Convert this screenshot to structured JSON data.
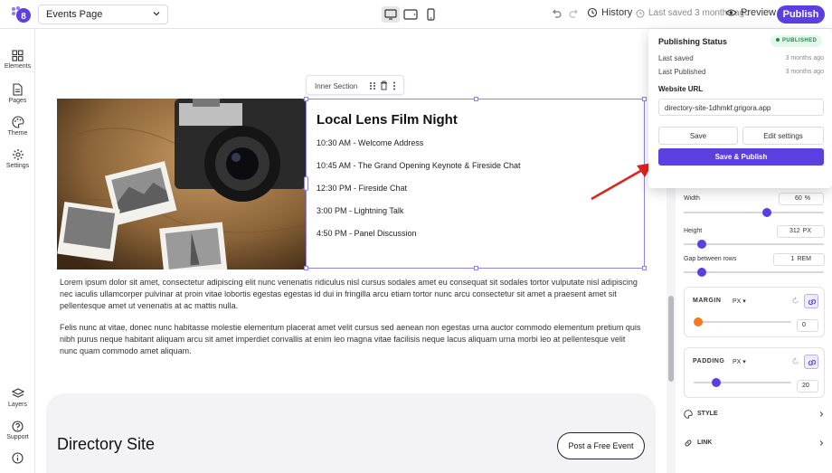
{
  "header": {
    "page_selector": "Events Page",
    "history_label": "History",
    "last_saved_text": "Last saved 3 months ago",
    "preview_label": "Preview",
    "publish_label": "Publish"
  },
  "sidebar": {
    "items": [
      {
        "label": "Elements"
      },
      {
        "label": "Pages"
      },
      {
        "label": "Theme"
      },
      {
        "label": "Settings"
      }
    ],
    "bottom_items": [
      {
        "label": "Layers"
      },
      {
        "label": "Support"
      }
    ]
  },
  "canvas": {
    "inner_section_label": "Inner Section",
    "event_title": "Local Lens Film Night",
    "schedule": [
      "10:30 AM - Welcome Address",
      "10:45 AM - The Grand Opening Keynote & Fireside Chat",
      "12:30 PM - Fireside Chat",
      "3:00 PM - Lightning Talk",
      "4:50 PM - Panel Discussion"
    ],
    "paragraph_1": "Lorem ipsum dolor sit amet, consectetur adipiscing elit nunc venenatis ridiculus nisl cursus sodales amet eu consequat sit sodales tortor vulputate nisl adipiscing nec iaculis ullamcorper pulvinar at proin vitae lobortis egestas egestas id dui in fringilla arcu etiam tortor nunc arcu consectetur sit amet a praesent amet sit pellentesque amet ut venenatis at ac mattis nulla.",
    "paragraph_2": "Felis nunc at vitae, donec nunc habitasse molestie elementum placerat amet velit cursus sed aenean non egestas urna auctor commodo elementum pretium quis nibh purus neque habitant aliquam arcu sit amet imperdiet convallis at enim leo magna vitae facilisis neque lacus aliquam urna morbi leo at pellentesque velit nunc quam commodo amet aliquam.",
    "directory_title": "Directory Site",
    "post_event_button": "Post a Free Event"
  },
  "publishing": {
    "title": "Publishing Status",
    "status_badge": "PUBLISHED",
    "last_saved_label": "Last saved",
    "last_saved_value": "3 months ago",
    "last_published_label": "Last Published",
    "last_published_value": "3 months ago",
    "url_label": "Website URL",
    "url_value": "directory-site-1dhmkf.grigora.app",
    "save_label": "Save",
    "edit_settings_label": "Edit settings",
    "save_publish_label": "Save & Publish",
    "status_color": "#1d8a4a",
    "accent_color": "#5b3fe0"
  },
  "properties": {
    "width_label": "Width",
    "width_value": "60",
    "width_unit": "%",
    "width_slider_pct": 60,
    "height_label": "Height",
    "height_value": "312",
    "height_unit": "PX",
    "height_slider_pct": 10,
    "gap_label": "Gap between rows",
    "gap_value": "1",
    "gap_unit": "REM",
    "gap_slider_pct": 10,
    "margin_title": "MARGIN",
    "margin_unit": "PX",
    "margin_value": "0",
    "margin_slider_pct": 0,
    "margin_knob_color": "#f57a1f",
    "padding_title": "PADDING",
    "padding_unit": "PX",
    "padding_value": "20",
    "padding_slider_pct": 20,
    "style_label": "STYLE",
    "link_label": "LINK"
  },
  "icons": [
    "logo-icon",
    "chevron-down-icon",
    "desktop-icon",
    "tablet-icon",
    "mobile-icon",
    "undo-icon",
    "redo-icon",
    "history-icon",
    "clock-icon",
    "eye-icon",
    "grid-icon",
    "pages-icon",
    "palette-icon",
    "gear-icon",
    "layers-icon",
    "help-icon",
    "info-icon",
    "drag-icon",
    "trash-icon",
    "more-icon",
    "link-icon",
    "reset-icon",
    "chevron-right-icon",
    "arrow-annotation"
  ]
}
